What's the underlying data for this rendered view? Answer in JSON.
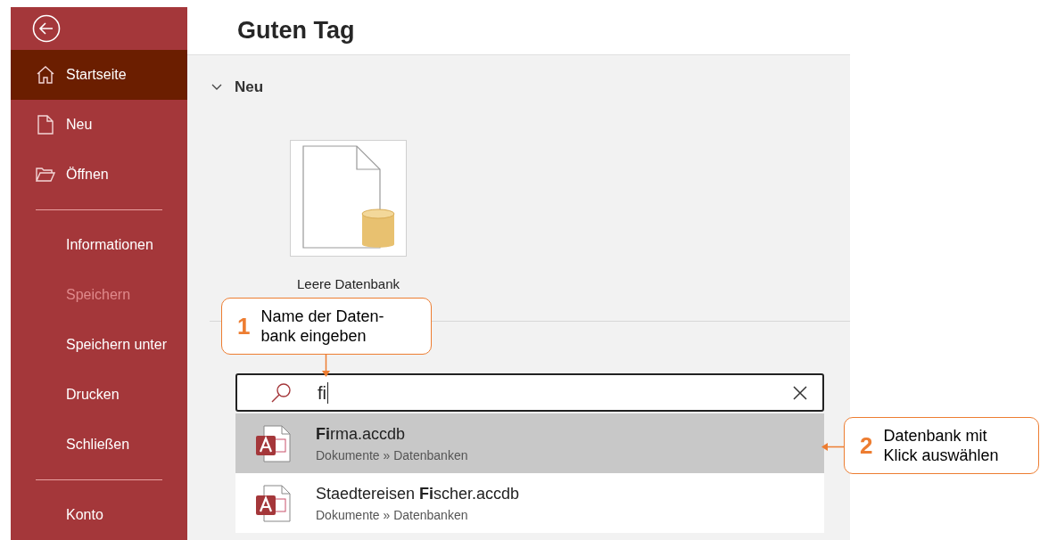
{
  "sidebar": {
    "groups": [
      [
        {
          "label": "Startseite",
          "selected": true,
          "disabled": false
        },
        {
          "label": "Neu",
          "selected": false,
          "disabled": false
        },
        {
          "label": "Öffnen",
          "selected": false,
          "disabled": false
        }
      ],
      [
        {
          "label": "Informationen",
          "selected": false,
          "disabled": false
        },
        {
          "label": "Speichern",
          "selected": false,
          "disabled": true
        },
        {
          "label": "Speichern unter",
          "selected": false,
          "disabled": false
        },
        {
          "label": "Drucken",
          "selected": false,
          "disabled": false
        },
        {
          "label": "Schließen",
          "selected": false,
          "disabled": false
        }
      ],
      [
        {
          "label": "Konto",
          "selected": false,
          "disabled": false
        }
      ]
    ]
  },
  "header": {
    "title": "Guten Tag"
  },
  "new_section": {
    "title": "Neu",
    "expanded": true,
    "templates": [
      {
        "label": "Leere Datenbank"
      }
    ]
  },
  "search": {
    "value": "fi"
  },
  "results": [
    {
      "name": "**Fi**rma.accdb",
      "path": "Dokumente » Datenbanken",
      "selected": true
    },
    {
      "name": "Staedtereisen **Fi**scher.accdb",
      "path": "Dokumente » Datenbanken",
      "selected": false
    }
  ],
  "annotations": [
    {
      "number": "1",
      "lines": [
        "Name der Daten-",
        "bank eingeben"
      ]
    },
    {
      "number": "2",
      "lines": [
        "Datenbank mit",
        "Klick auswählen"
      ]
    }
  ]
}
